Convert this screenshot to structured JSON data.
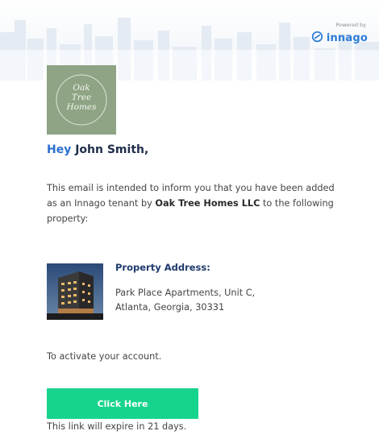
{
  "header": {
    "powered_by": "Powered by",
    "brand_name": "innago",
    "brand_icon": "innago-logo-icon",
    "brand_color": "#2b7bd6"
  },
  "logo": {
    "line1": "Oak",
    "line2": "Tree",
    "line3": "Homes",
    "background": "#8ea484"
  },
  "greeting": {
    "hey": "Hey",
    "name": "John Smith,"
  },
  "intro": {
    "text_before": "This email is intended to inform you that you have been added as an Innago tenant by ",
    "landlord": "Oak Tree Homes LLC",
    "text_after": " to the following property:"
  },
  "property": {
    "label": "Property Address:",
    "line1": "Park Place Apartments, Unit C,",
    "line2": "Atlanta, Georgia, 30331"
  },
  "activate_text": "To activate your account.",
  "cta": {
    "label": "Click Here",
    "color": "#17d48c"
  },
  "expire_text": "This link will expire in 21 days."
}
